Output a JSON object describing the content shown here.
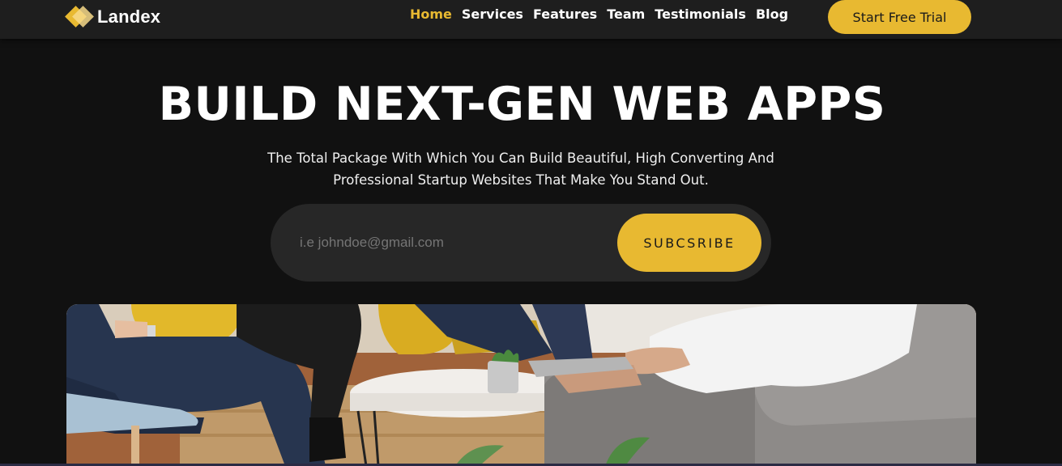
{
  "brand": {
    "name": "Landex",
    "logo_icon": "stacked-diamond-logo",
    "accent_color": "#e8b931",
    "background_color": "#111111"
  },
  "nav": {
    "items": [
      {
        "label": "Home",
        "active": true
      },
      {
        "label": "Services",
        "active": false
      },
      {
        "label": "Features",
        "active": false
      },
      {
        "label": "Team",
        "active": false
      },
      {
        "label": "Testimonials",
        "active": false
      },
      {
        "label": "Blog",
        "active": false
      }
    ],
    "cta_label": "Start Free Trial"
  },
  "hero": {
    "title": "BUILD NEXT-GEN WEB APPS",
    "subtitle": "The Total Package With Which You Can Build Beautiful, High Converting And Professional Startup Websites That Make You Stand Out.",
    "email_placeholder": "i.e johndoe@gmail.com",
    "subscribe_label": "SUBCSRIBE",
    "image_subject": "team-meeting-photo"
  }
}
